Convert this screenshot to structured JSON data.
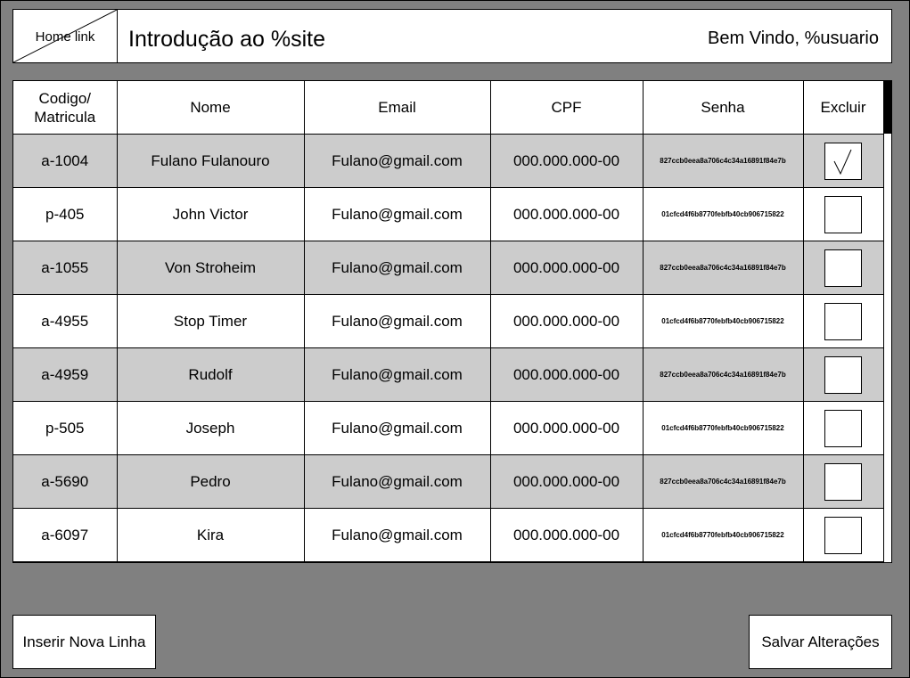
{
  "header": {
    "home_link": "Home link",
    "title": "Introdução ao %site",
    "welcome": "Bem Vindo, %usuario"
  },
  "table": {
    "columns": {
      "code_line1": "Codigo/",
      "code_line2": "Matricula",
      "name": "Nome",
      "email": "Email",
      "cpf": "CPF",
      "password": "Senha",
      "delete": "Excluir"
    },
    "rows": [
      {
        "code": "a-1004",
        "name": "Fulano Fulanouro",
        "email": "Fulano@gmail.com",
        "cpf": "000.000.000-00",
        "password": "827ccb0eea8a706c4c34a16891f84e7b",
        "delete": true
      },
      {
        "code": "p-405",
        "name": "John Victor",
        "email": "Fulano@gmail.com",
        "cpf": "000.000.000-00",
        "password": "01cfcd4f6b8770febfb40cb906715822",
        "delete": false
      },
      {
        "code": "a-1055",
        "name": "Von Stroheim",
        "email": "Fulano@gmail.com",
        "cpf": "000.000.000-00",
        "password": "827ccb0eea8a706c4c34a16891f84e7b",
        "delete": false
      },
      {
        "code": "a-4955",
        "name": "Stop Timer",
        "email": "Fulano@gmail.com",
        "cpf": "000.000.000-00",
        "password": "01cfcd4f6b8770febfb40cb906715822",
        "delete": false
      },
      {
        "code": "a-4959",
        "name": "Rudolf",
        "email": "Fulano@gmail.com",
        "cpf": "000.000.000-00",
        "password": "827ccb0eea8a706c4c34a16891f84e7b",
        "delete": false
      },
      {
        "code": "p-505",
        "name": "Joseph",
        "email": "Fulano@gmail.com",
        "cpf": "000.000.000-00",
        "password": "01cfcd4f6b8770febfb40cb906715822",
        "delete": false
      },
      {
        "code": "a-5690",
        "name": "Pedro",
        "email": "Fulano@gmail.com",
        "cpf": "000.000.000-00",
        "password": "827ccb0eea8a706c4c34a16891f84e7b",
        "delete": false
      },
      {
        "code": "a-6097",
        "name": "Kira",
        "email": "Fulano@gmail.com",
        "cpf": "000.000.000-00",
        "password": "01cfcd4f6b8770febfb40cb906715822",
        "delete": false
      }
    ]
  },
  "actions": {
    "insert_row": "Inserir Nova Linha",
    "save_changes": "Salvar Alterações"
  },
  "colors": {
    "background": "#808080",
    "row_shaded": "#cccccc",
    "row_plain": "#ffffff"
  }
}
